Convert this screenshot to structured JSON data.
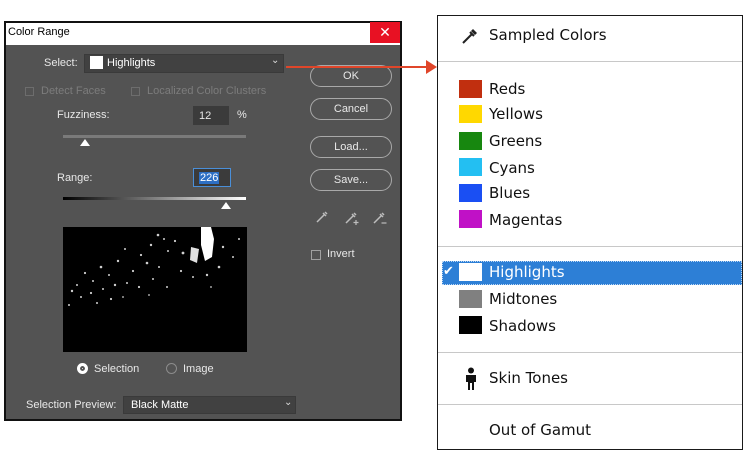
{
  "dialog": {
    "title": "Color Range",
    "close_glyph": "✕",
    "select_label": "Select:",
    "select_value": "Highlights",
    "select_swatch_color": "#ffffff",
    "detect_faces_label": "Detect Faces",
    "localized_label": "Localized Color Clusters",
    "fuzziness_label": "Fuzziness:",
    "fuzziness_value": "12",
    "fuzziness_unit": "%",
    "fuzziness_slider_fraction": 0.12,
    "range_label": "Range:",
    "range_value": "226",
    "range_slider_fraction": 0.89,
    "radio_selection": "Selection",
    "radio_image": "Image",
    "selected_radio": "Selection",
    "preview_label": "Selection Preview:",
    "preview_value": "Black Matte",
    "buttons": {
      "ok": "OK",
      "cancel": "Cancel",
      "load": "Load...",
      "save": "Save..."
    },
    "invert_label": "Invert",
    "eyedroppers": [
      "eyedropper-icon",
      "eyedropper-plus-icon",
      "eyedropper-minus-icon"
    ]
  },
  "menu": {
    "sampled": {
      "label": "Sampled Colors",
      "icon": "eyedropper-icon"
    },
    "colors": [
      {
        "label": "Reds",
        "color": "#c12f0f"
      },
      {
        "label": "Yellows",
        "color": "#ffd800"
      },
      {
        "label": "Greens",
        "color": "#17870f"
      },
      {
        "label": "Cyans",
        "color": "#23bff2"
      },
      {
        "label": "Blues",
        "color": "#1a4ff3"
      },
      {
        "label": "Magentas",
        "color": "#c011c6"
      }
    ],
    "tones": [
      {
        "label": "Highlights",
        "color": "#ffffff",
        "selected": true
      },
      {
        "label": "Midtones",
        "color": "#808080"
      },
      {
        "label": "Shadows",
        "color": "#000000"
      }
    ],
    "skin": {
      "label": "Skin Tones",
      "icon": "person-icon"
    },
    "gamut": {
      "label": "Out of Gamut"
    },
    "check_glyph": "✔"
  },
  "arrow_color": "#e0462a"
}
